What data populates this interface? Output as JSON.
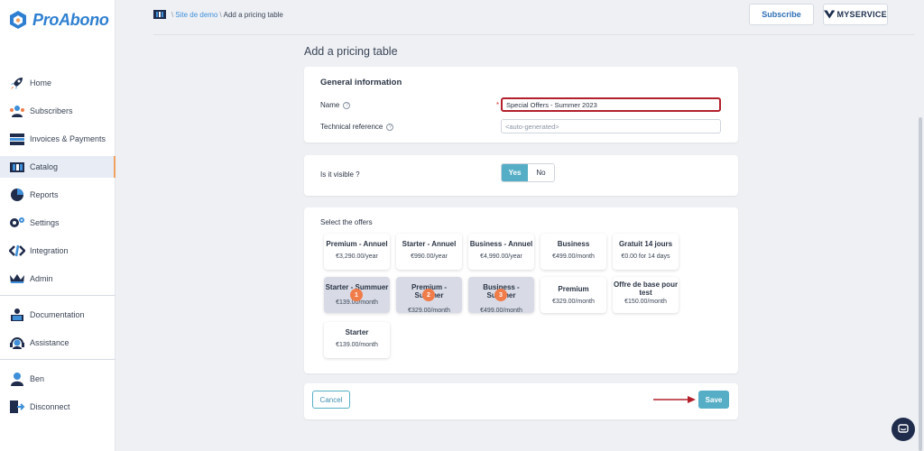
{
  "app": {
    "logo_text": "ProAbono"
  },
  "sidebar": {
    "items": [
      {
        "label": "Home",
        "icon": "rocket-icon"
      },
      {
        "label": "Subscribers",
        "icon": "subscribers-icon"
      },
      {
        "label": "Invoices & Payments",
        "icon": "invoices-icon"
      },
      {
        "label": "Catalog",
        "icon": "catalog-icon"
      },
      {
        "label": "Reports",
        "icon": "pie-chart-icon"
      },
      {
        "label": "Settings",
        "icon": "gear-icon"
      },
      {
        "label": "Integration",
        "icon": "code-icon"
      },
      {
        "label": "Admin",
        "icon": "crown-icon"
      }
    ],
    "secondary": [
      {
        "label": "Documentation",
        "icon": "book-icon"
      },
      {
        "label": "Assistance",
        "icon": "headset-icon"
      }
    ],
    "user": [
      {
        "label": "Ben",
        "icon": "user-icon"
      },
      {
        "label": "Disconnect",
        "icon": "exit-icon"
      }
    ]
  },
  "breadcrumb": {
    "sep": "\\",
    "site": "Site de demo",
    "current": "Add a pricing table"
  },
  "header": {
    "subscribe_label": "Subscribe",
    "brand_label": "MYSERVICE"
  },
  "page": {
    "title": "Add a pricing table"
  },
  "general": {
    "title": "General information",
    "name_label": "Name",
    "name_value": "Special Offers - Summer 2023",
    "required_mark": "*",
    "help_glyph": "?",
    "techref_label": "Technical reference",
    "techref_placeholder": "<auto-generated>"
  },
  "visibility": {
    "label": "Is it visible ?",
    "yes": "Yes",
    "no": "No",
    "selected": "Yes"
  },
  "offers": {
    "title": "Select the offers",
    "items": [
      {
        "name": "Premium - Annuel",
        "price": "€3,290.00/year",
        "selected": false
      },
      {
        "name": "Starter - Annuel",
        "price": "€990.00/year",
        "selected": false
      },
      {
        "name": "Business - Annuel",
        "price": "€4,990.00/year",
        "selected": false
      },
      {
        "name": "Business",
        "price": "€499.00/month",
        "selected": false
      },
      {
        "name": "Gratuit 14 jours",
        "price": "€0.00 for 14 days",
        "selected": false
      },
      {
        "name": "Starter - Summuer",
        "price": "€139.00/month",
        "selected": true,
        "badge": "1"
      },
      {
        "name": "Premium - Summer",
        "price": "€329.00/month",
        "selected": true,
        "badge": "2"
      },
      {
        "name": "Business - Summer",
        "price": "€499.00/month",
        "selected": true,
        "badge": "3"
      },
      {
        "name": "Premium",
        "price": "€329.00/month",
        "selected": false
      },
      {
        "name": "Offre de base pour test",
        "price": "€150.00/month",
        "selected": false
      },
      {
        "name": "Starter",
        "price": "€139.00/month",
        "selected": false
      }
    ]
  },
  "actions": {
    "cancel": "Cancel",
    "save": "Save"
  },
  "colors": {
    "accent": "#55aec5",
    "badge": "#f07c4a",
    "highlight": "#b3202c",
    "brand_blue": "#2e7fd1"
  }
}
